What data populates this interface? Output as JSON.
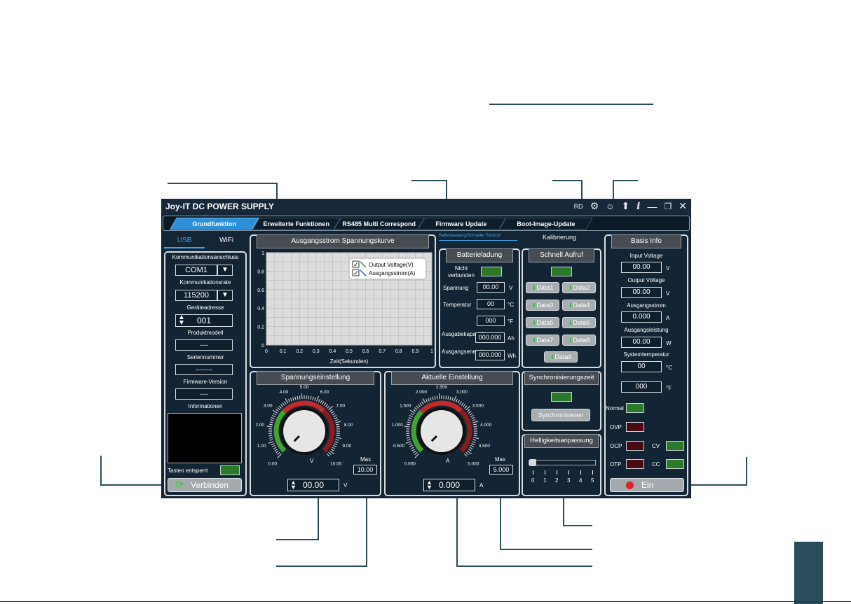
{
  "window": {
    "title": "Joy-IT DC POWER SUPPLY",
    "rd": "RD"
  },
  "icons": {
    "settings": "gear-icon",
    "user": "user-icon",
    "upload": "arrow-up-icon",
    "info": "info-icon",
    "minimize": "minimize-icon",
    "restore": "restore-icon",
    "close": "close-icon"
  },
  "tabs": [
    "Grundfunktion",
    "Erweiterte Funktionen",
    "RS485 Multi Correspond",
    "Firmware Update",
    "Boot-Image-Update"
  ],
  "subtabs": {
    "battery": "Batterieladung/Schneller Rückruf",
    "calib": "Kalibrierung"
  },
  "conn": {
    "usb": "USB",
    "wifi": "WiFi",
    "port_label": "Kommunikationsanschluss",
    "port_value": "COM1",
    "rate_label": "Kommunikationsrate",
    "rate_value": "115200",
    "addr_label": "Geräteadresse",
    "addr_value": "001",
    "model_label": "Produktmodell",
    "model_value": "----",
    "serial_label": "Seriennummer",
    "serial_value": "--------",
    "fw_label": "Firmware-Version",
    "fw_value": "----",
    "info_label": "Informationen",
    "keys_label": "Tasten entsperrt",
    "connect_button": "Verbinden"
  },
  "curve": {
    "title": "Ausgangsstrom Spannungskurve",
    "legend1": "Output Voltage(V)",
    "legend2": "Ausgangsstrom(A)",
    "xlabel": "Zeit(Sekunden)",
    "yticks": [
      "0",
      "0.2",
      "0.4",
      "0.6",
      "0.8",
      "1"
    ],
    "xticks": [
      "0",
      "0.1",
      "0.2",
      "0.3",
      "0.4",
      "0.5",
      "0.6",
      "0.7",
      "0.8",
      "0.9",
      "1"
    ]
  },
  "battery": {
    "title": "Batterieladung",
    "status": "Nicht verbunden",
    "volt_label": "Spannung",
    "volt_value": "00.00",
    "volt_unit": "V",
    "temp_label": "Temperatur",
    "temp_c": "00",
    "temp_c_unit": "°C",
    "temp_f": "000",
    "temp_f_unit": "°F",
    "cap_label": "Ausgabekapazität",
    "cap_value": "000.000",
    "cap_unit": "Ah",
    "energy_label": "Ausgangsenergie",
    "energy_value": "000.000",
    "energy_unit": "Wh"
  },
  "quick": {
    "title": "Schnell Aufruf",
    "buttons": [
      "Data1",
      "Data2",
      "Data3",
      "Data4",
      "Data5",
      "Data6",
      "Data7",
      "Data8",
      "Data9"
    ]
  },
  "sync": {
    "title": "Synchronisierungszeit",
    "button": "Synchronisieren"
  },
  "brightness": {
    "title": "Helligkeitsanpassung",
    "ticks": [
      "0",
      "1",
      "2",
      "3",
      "4",
      "5"
    ],
    "level": 0
  },
  "basis": {
    "title": "Basis Info",
    "input_label": "Input Voltage",
    "input_value": "00.00",
    "output_label": "Output Voltage",
    "output_value": "00.00",
    "current_label": "Ausgangsstrom",
    "current_value": "0.000",
    "power_label": "Ausgangsleistung",
    "power_value": "00.00",
    "temp_label": "Systemtemperatur",
    "temp_c": "00",
    "temp_f": "000",
    "v": "V",
    "a": "A",
    "w": "W",
    "c": "°C",
    "f": "°F",
    "normal": "Normal",
    "ovp": "OVP",
    "ocp": "OCP",
    "otp": "OTP",
    "cv": "CV",
    "cc": "CC",
    "on_button": "Ein"
  },
  "voltage": {
    "title": "Spannungseinstellung",
    "scale": [
      "0.00",
      "1.00",
      "2.00",
      "3.00",
      "4.00",
      "5.00",
      "6.00",
      "7.00",
      "8.00",
      "9.00",
      "10.00"
    ],
    "unit_label": "V",
    "max_label": "Max",
    "max_value": "10.00",
    "value": "00.00",
    "unit": "V"
  },
  "current": {
    "title": "Aktuelle Einstellung",
    "scale": [
      "0.000",
      "0.500",
      "1.000",
      "1.500",
      "2.000",
      "2.500",
      "3.000",
      "3.500",
      "4.000",
      "4.500",
      "5.000"
    ],
    "unit_label": "A",
    "max_label": "Max",
    "max_value": "5.000",
    "value": "0.000",
    "unit": "A"
  },
  "colors": {
    "accent": "#2d8fd5",
    "bg": "#142536",
    "callout": "#2a4d5c",
    "led_green": "#2a7a2a",
    "led_red": "#4a0a14",
    "on_red": "#e0202a"
  }
}
